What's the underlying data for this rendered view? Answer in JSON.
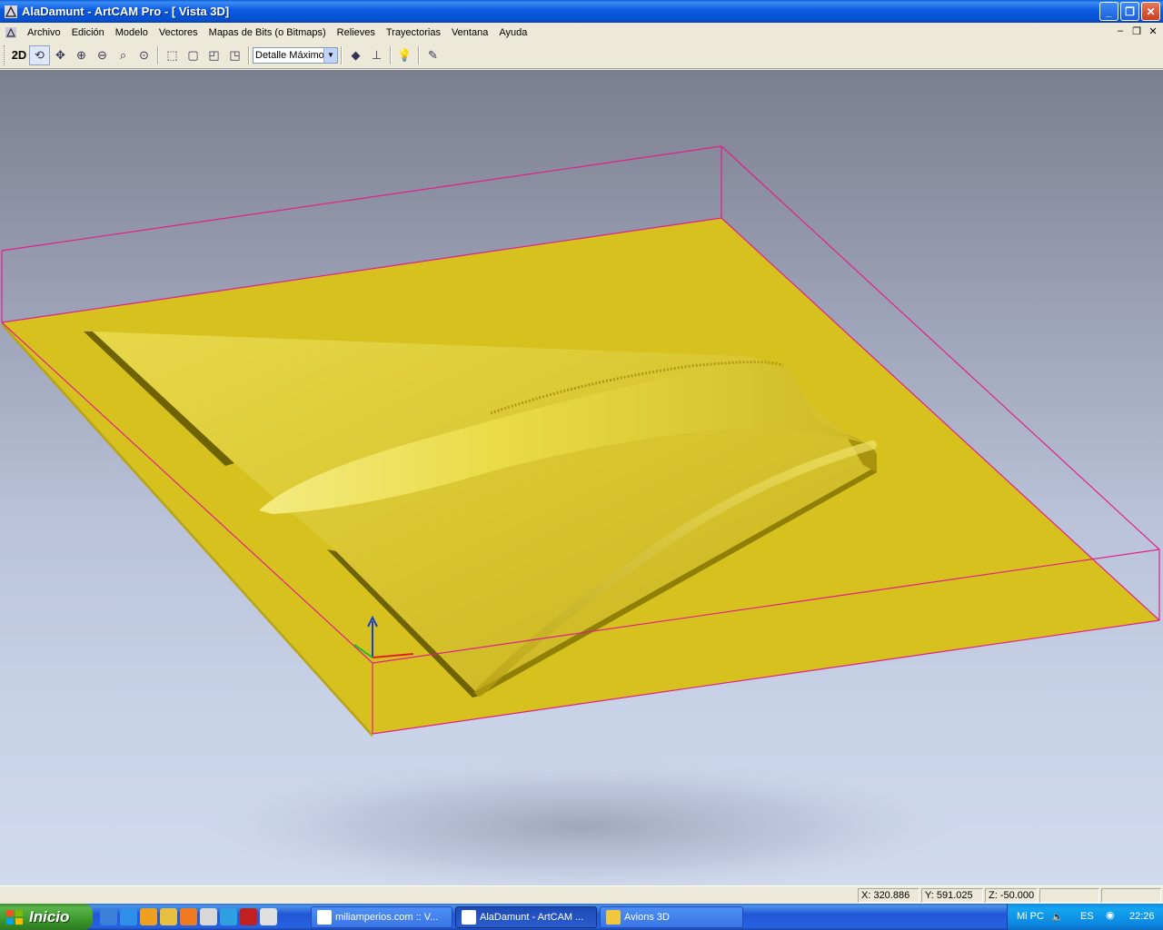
{
  "window": {
    "title": "AlaDamunt - ArtCAM Pro - [ Vista 3D]",
    "minimize_glyph": "_",
    "restore_glyph": "❐",
    "close_glyph": "✕"
  },
  "menu": {
    "items": [
      "Archivo",
      "Edición",
      "Modelo",
      "Vectores",
      "Mapas de Bits (o Bitmaps)",
      "Relieves",
      "Trayectorias",
      "Ventana",
      "Ayuda"
    ],
    "mdi_minimize": "–",
    "mdi_restore": "❐",
    "mdi_close": "✕"
  },
  "toolbar": {
    "mode_label": "2D",
    "detail_select": "Detalle Máximo",
    "icons": [
      "rotate-view-icon",
      "pan-icon",
      "zoom-in-icon",
      "zoom-out-icon",
      "zoom-box-icon",
      "zoom-fit-icon",
      "iso-view-icon",
      "front-view-icon",
      "top-view-icon",
      "side-view-icon",
      "draw-plane-icon",
      "axes-icon",
      "light-icon",
      "paint-icon"
    ]
  },
  "status": {
    "x": "X: 320.886",
    "y": "Y: 591.025",
    "z": "Z: -50.000"
  },
  "taskbar": {
    "start_label": "Inicio",
    "tasks": [
      {
        "label": "miliamperios.com :: V..."
      },
      {
        "label": "AlaDamunt - ArtCAM ..."
      },
      {
        "label": "Avions 3D"
      }
    ],
    "tray_label": "Mi PC",
    "language": "ES",
    "clock": "22:26"
  },
  "colors": {
    "model_yellow": "#d9c21f",
    "bounding_box": "#e0208a",
    "titlebar_blue": "#0b5ae0"
  }
}
